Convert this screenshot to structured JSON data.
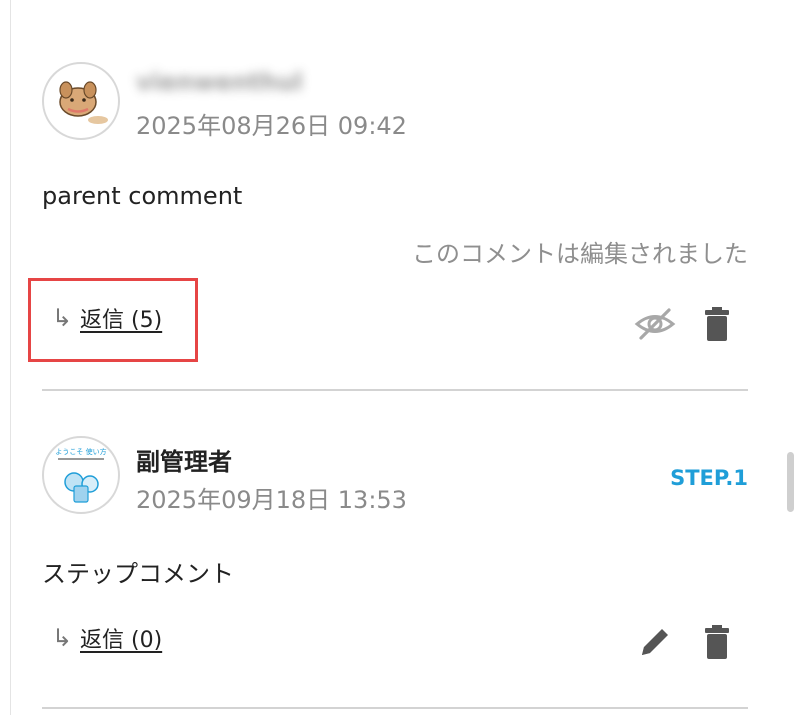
{
  "comments": [
    {
      "avatar": "puppy-avatar",
      "name": "vienwenthul",
      "date": "2025年08月26日 09:42",
      "body": "parent comment",
      "edited_note": "このコメントは編集されました",
      "reply_label": "返信 (5)",
      "actions": [
        "eye-off-icon",
        "trash-icon"
      ],
      "highlighted": true
    },
    {
      "avatar": "step-logo-avatar",
      "avatar_text": "ようこそ 使い方",
      "name": "副管理者",
      "date": "2025年09月18日 13:53",
      "step_label": "STEP.1",
      "body": "ステップコメント",
      "reply_label": "返信 (0)",
      "actions": [
        "pencil-icon",
        "trash-icon"
      ]
    }
  ],
  "colors": {
    "accent": "#1f9ed8",
    "highlight": "#e64545",
    "muted_text": "#8a8a8a",
    "icon": "#555555"
  },
  "reply_arrow_glyph": "↳"
}
